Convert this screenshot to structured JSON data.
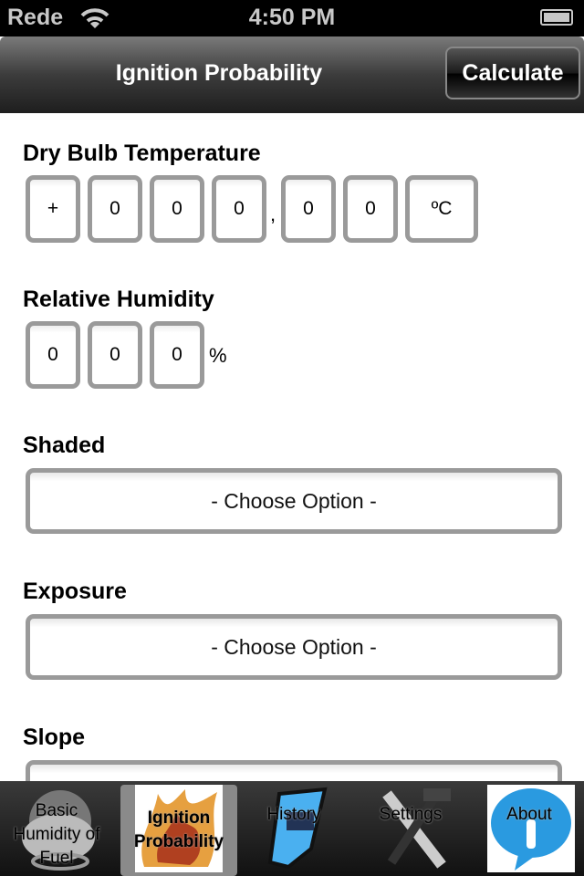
{
  "status_bar": {
    "carrier": "Rede",
    "time": "4:50 PM"
  },
  "nav": {
    "title": "Ignition Probability",
    "calculate_label": "Calculate"
  },
  "dry_bulb": {
    "label": "Dry Bulb Temperature",
    "sign": "+",
    "digits": [
      "0",
      "0",
      "0",
      "0",
      "0"
    ],
    "decimal_separator": ",",
    "unit": "ºC"
  },
  "humidity": {
    "label": "Relative Humidity",
    "digits": [
      "0",
      "0",
      "0"
    ],
    "unit": "%"
  },
  "shaded": {
    "label": "Shaded",
    "value": "- Choose Option -"
  },
  "exposure": {
    "label": "Exposure",
    "value": "- Choose Option -"
  },
  "slope": {
    "label": "Slope"
  },
  "tabs": [
    {
      "label": "Basic Humidity of Fuel",
      "icon": "cloud-icon"
    },
    {
      "label": "Ignition Probability",
      "icon": "flame-icon",
      "selected": true
    },
    {
      "label": "History",
      "icon": "scroll-icon"
    },
    {
      "label": "Settings",
      "icon": "tools-icon"
    },
    {
      "label": "About",
      "icon": "info-bubble-icon"
    }
  ]
}
